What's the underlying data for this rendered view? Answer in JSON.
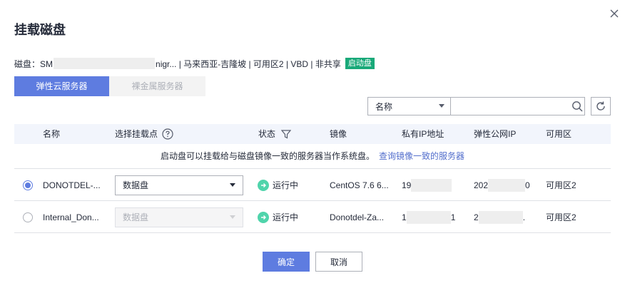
{
  "dialog": {
    "title": "挂载磁盘",
    "close_icon": "close-icon"
  },
  "disk_info": {
    "prefix": "磁盘：SM",
    "suffix": "nigr... | 马来西亚-吉隆坡 | 可用区2 | VBD | 非共享",
    "badge": "启动盘",
    "badge_color": "#19a979"
  },
  "tabs": [
    {
      "label": "弹性云服务器",
      "active": true
    },
    {
      "label": "裸金属服务器",
      "active": false
    }
  ],
  "search": {
    "field": "名称",
    "value": "",
    "search_icon": "search-icon",
    "refresh_icon": "refresh-icon"
  },
  "table": {
    "headers": {
      "name": "名称",
      "mount_point": "选择挂载点",
      "status": "状态",
      "image": "镜像",
      "private_ip": "私有IP地址",
      "eip": "弹性公网IP",
      "az": "可用区"
    },
    "notice": {
      "text": "启动盘可以挂载给与磁盘镜像一致的服务器当作系统盘。",
      "link": "查询镜像一致的服务器"
    },
    "rows": [
      {
        "selected": true,
        "name": "DONOTDEL-...",
        "mount_point": "数据盘",
        "mount_disabled": false,
        "status": "运行中",
        "image": "CentOS 7.6 6...",
        "private_ip_prefix": "19",
        "private_ip_suffix": "",
        "eip_prefix": "202",
        "eip_suffix": "0",
        "az": "可用区2"
      },
      {
        "selected": false,
        "name": "Internal_Don...",
        "mount_point": "数据盘",
        "mount_disabled": true,
        "status": "运行中",
        "image": "Donotdel-Za...",
        "private_ip_prefix": "1",
        "private_ip_suffix": "1",
        "eip_prefix": "2",
        "eip_suffix": ".",
        "az": "可用区2"
      }
    ]
  },
  "footer": {
    "ok_label": "确定",
    "cancel_label": "取消"
  },
  "colors": {
    "primary": "#5e7ce0",
    "status_running": "#50d4ab",
    "link": "#526ecc"
  }
}
